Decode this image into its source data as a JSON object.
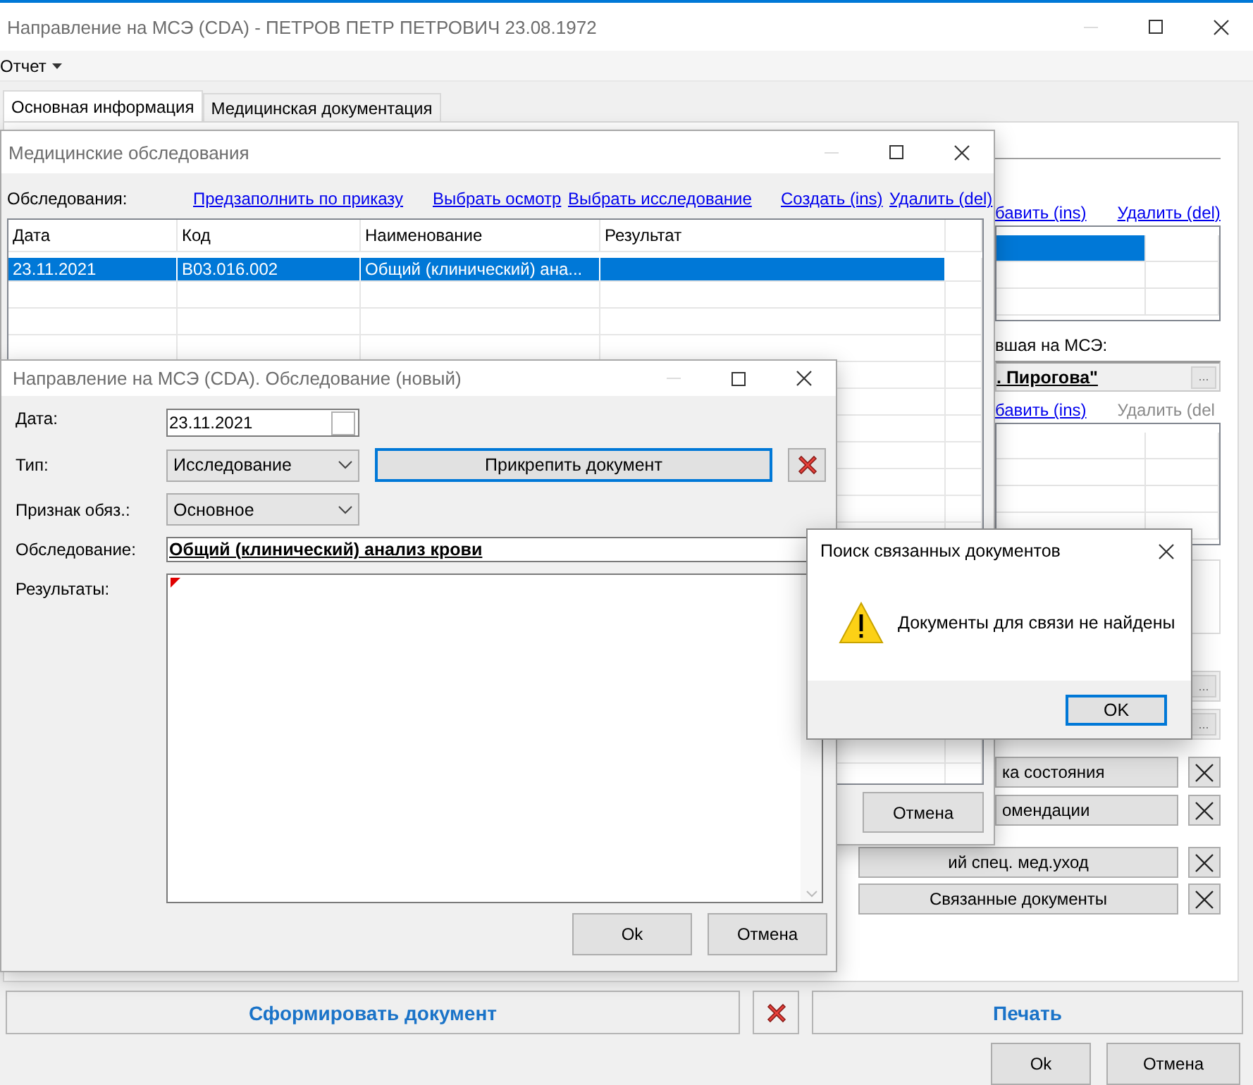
{
  "main_window": {
    "title": "Направление на МСЭ (CDA) - ПЕТРОВ ПЕТР ПЕТРОВИЧ 23.08.1972",
    "menu": [
      {
        "label": "Отчет"
      }
    ],
    "tabs": [
      {
        "label": "Основная информация",
        "selected": true
      },
      {
        "label": "Медицинская документация",
        "selected": false
      }
    ],
    "right_panel": {
      "links_top": [
        {
          "label": "бавить (ins)",
          "disabled": false
        },
        {
          "label": "Удалить (del)",
          "disabled": false
        }
      ],
      "grid_top_rows": [
        {
          "selected": true
        },
        {
          "selected": false
        },
        {
          "selected": false
        }
      ],
      "org_label": "вшая на МСЭ:",
      "org_value": ". Пирогова\"",
      "org_button": "...",
      "links_bottom": [
        {
          "label": "бавить (ins)",
          "disabled": false
        },
        {
          "label": "Удалить (del",
          "disabled": true
        }
      ],
      "grid_bottom_rows": [
        {
          "selected": false
        },
        {
          "selected": false
        },
        {
          "selected": false
        },
        {
          "selected": false
        }
      ],
      "lookup_fields": [
        {
          "button": "..."
        },
        {
          "button": "..."
        }
      ],
      "actions": [
        {
          "label": "ка состояния"
        },
        {
          "label": "омендации"
        },
        {
          "label": "ий спец. мед.уход"
        },
        {
          "label": "Связанные документы"
        }
      ]
    },
    "generate_button": "Сформировать документ",
    "print_button": "Печать",
    "buttons": [
      "Ok",
      "Отмена"
    ]
  },
  "exams_window": {
    "title": "Медицинские обследования",
    "label": "Обследования:",
    "links": [
      {
        "label": "Предзаполнить по приказу"
      },
      {
        "label": "Выбрать осмотр"
      },
      {
        "label": "Выбрать исследование"
      },
      {
        "label": "Создать (ins)"
      },
      {
        "label": "Удалить (del)"
      }
    ],
    "columns": [
      "Дата",
      "Код",
      "Наименование",
      "Результат"
    ],
    "rows": [
      {
        "cells": [
          "23.11.2021",
          "B03.016.002",
          "Общий (клинический) ана..."
        ],
        "selected": true
      }
    ],
    "buttons": [
      "Отмена"
    ]
  },
  "exam_dialog": {
    "title": "Направление на МСЭ (CDA). Обследование (новый)",
    "date_label": "Дата:",
    "date_value": "23.11.2021",
    "date_checked": false,
    "type_label": "Тип:",
    "type_value": "Исследование",
    "attach_button": {
      "label": "Прикрепить документ",
      "focused": true
    },
    "sign_label": "Признак обяз.:",
    "sign_value": "Основное",
    "exam_label": "Обследование:",
    "exam_value": "Общий (клинический) анализ крови",
    "results_label": "Результаты:",
    "buttons": [
      "Ok",
      "Отмена"
    ]
  },
  "message_box": {
    "title": "Поиск связанных документов",
    "message": "Документы для связи не найдены",
    "buttons": [
      {
        "label": "OK",
        "focused": true
      }
    ]
  }
}
